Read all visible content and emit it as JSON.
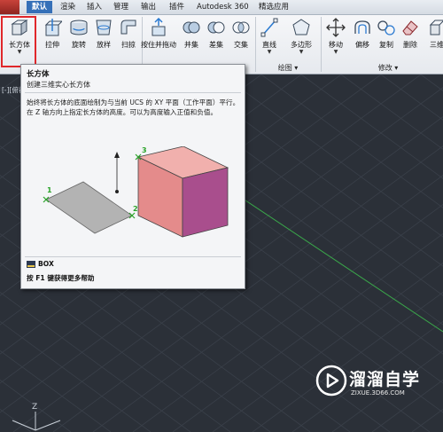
{
  "tabs": [
    "默认",
    "渲染",
    "插入",
    "管理",
    "输出",
    "插件",
    "Autodesk 360",
    "精选应用"
  ],
  "active_tab": "默认",
  "ribbon": {
    "buttons": {
      "box": "长方体",
      "extrude": "拉伸",
      "revolve": "旋转",
      "loft": "放样",
      "sweep": "扫掠",
      "presspull": "按住并拖动",
      "union": "并集",
      "subtract": "差集",
      "intersect": "交集",
      "line": "直线",
      "polygon": "多边形",
      "move": "移动",
      "offset": "偏移",
      "copy": "复制",
      "erase": "删除",
      "three_d": "三维"
    },
    "panels": {
      "draw": "绘图 ▾",
      "modify": "修改 ▾"
    }
  },
  "viewport": {
    "label": "[-][俯视]"
  },
  "tooltip": {
    "title": "长方体",
    "subtitle": "创建三维实心长方体",
    "description": "始终将长方体的底面绘制为与当前 UCS 的 XY 平面（工作平面）平行。在 Z 轴方向上指定长方体的高度。可以为高度输入正值和负值。",
    "figure_labels": [
      "1",
      "2",
      "3"
    ],
    "command": "BOX",
    "help": "按 F1 键获得更多帮助"
  },
  "ucs_axis_label": "Z",
  "watermark": {
    "cn": "溜溜自学",
    "en": "ZIXUE.3D66.COM"
  },
  "colors": {
    "ribbon_bg": "#eceff3",
    "active_tab": "#3570b8",
    "highlight": "#e0272b",
    "canvas_bg": "#2b3038",
    "box_face": "#e58a8a",
    "box_side": "#a84d8b",
    "grid_axis": "#3aa64a"
  }
}
